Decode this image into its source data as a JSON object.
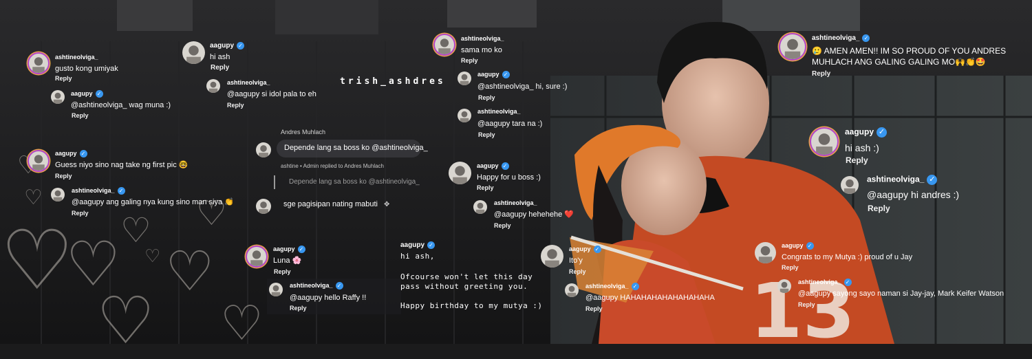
{
  "watermark": "trish_ashdres",
  "accent": {
    "verified": "#3897f0",
    "ring_purple": "#b347c6",
    "ring_orange": "#e8a24b",
    "emoji_heart": "#e0304a"
  },
  "icons": [
    "verified-badge-icon",
    "heart-doodle-icon",
    "avatar-icon",
    "edit-icon"
  ],
  "col1": {
    "c1": {
      "user": "ashtineolviga_",
      "text": "gusto kong umiyak",
      "reply": "Reply"
    },
    "c2": {
      "user": "aagupy",
      "text": "@ashtineolviga_ wag muna :)",
      "reply": "Reply"
    },
    "c3": {
      "user": "aagupy",
      "text": "Guess niyo sino nag take ng first pic 🤓",
      "reply": "Reply"
    },
    "c4": {
      "user": "ashtineolviga_",
      "text": "@aagupy ang galing nya kung sino man siya 👏",
      "reply": "Reply"
    }
  },
  "col2": {
    "c1": {
      "user": "aagupy",
      "text": "hi ash",
      "reply": "Reply"
    },
    "c2": {
      "user": "ashtineolviga_",
      "text": "@aagupy si idol pala to eh",
      "reply": "Reply"
    }
  },
  "fb": {
    "name": "Andres Muhlach",
    "text": "Depende lang sa boss ko @ashtineolviga_",
    "admin_note": "ashtine • Admin replied to Andres Muhlach",
    "quoted": "Depende lang sa boss ko @ashtineolviga_",
    "reply_text": "sge pagisipan nating mabuti",
    "reply_icon": "✥"
  },
  "col3": {
    "c1": {
      "user": "aagupy",
      "text": "Luna 🌸",
      "reply": "Reply"
    },
    "c2": {
      "user": "ashtineolviga_",
      "text": "@aagupy hello Raffy !!",
      "reply": "Reply"
    }
  },
  "col4": {
    "c1": {
      "user": "ashtineolviga_",
      "text": "sama mo ko",
      "reply": "Reply"
    },
    "c2": {
      "user": "aagupy",
      "text": "@ashtineolviga_ hi, sure :)",
      "reply": "Reply"
    },
    "c3": {
      "user": "ashtineolviga_",
      "text": "@aagupy tara na :)",
      "reply": "Reply"
    },
    "c4": {
      "user": "aagupy",
      "text": "Happy for u boss :)",
      "reply": "Reply"
    },
    "c5": {
      "user": "ashtineolviga_",
      "text": "@aagupy hehehehe ❤️",
      "reply": "Reply"
    }
  },
  "post": {
    "user": "aagupy",
    "line1": "hi ash,",
    "line2": "Ofcourse won't let this day",
    "line3": "pass without greeting you.",
    "line4": "Happy birthday to my mutya :)"
  },
  "col5": {
    "c1": {
      "user": "aagupy",
      "text": "Ito'y",
      "reply": "Reply"
    },
    "c2": {
      "user": "ashtineolviga_",
      "text": "@aagupy HAHAHAHAHAHAHAHAHA",
      "reply": "Reply"
    }
  },
  "col6": {
    "c1": {
      "user": "ashtineolviga_",
      "text1": "🥲 AMEN AMEN!! IM SO PROUD OF YOU ANDRES",
      "text2": "MUHLACH ANG GALING GALING MO🙌👏🤩",
      "reply": "Reply"
    },
    "c2": {
      "user": "aagupy",
      "text": "hi ash :)",
      "reply": "Reply"
    },
    "c3": {
      "user": "ashtineolviga_",
      "text": "@aagupy hi andres :)",
      "reply": "Reply"
    },
    "c4": {
      "user": "aagupy",
      "text": "Congrats to my Mutya :) proud of u Jay",
      "reply": "Reply"
    },
    "c5": {
      "user": "ashtineolviga_",
      "text": "@aagupy sayong sayo naman si Jay-jay, Mark Keifer Watson",
      "reply": "Reply"
    }
  },
  "background": {
    "jersey_number": "13"
  }
}
